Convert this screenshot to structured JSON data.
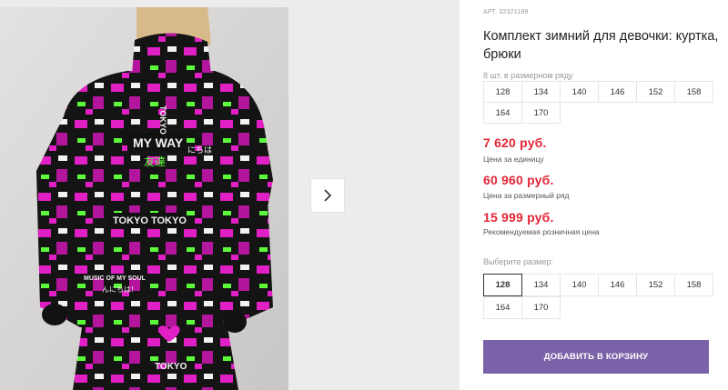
{
  "product": {
    "article": "АРТ. 32321189",
    "title": "Комплект зимний для девочки: куртка, брюки"
  },
  "range": {
    "label": "8 шт. в размерном ряду",
    "sizes": [
      "128",
      "134",
      "140",
      "146",
      "152",
      "158",
      "164",
      "170"
    ]
  },
  "prices": [
    {
      "value": "7 620 руб.",
      "note": "Цена за единицу"
    },
    {
      "value": "60 960 руб.",
      "note": "Цена за размерный ряд"
    },
    {
      "value": "15 999 руб.",
      "note": "Рекомендуемая розничная цена"
    }
  ],
  "size_picker": {
    "label": "Выберите размер:",
    "selected": "128",
    "sizes": [
      "128",
      "134",
      "140",
      "146",
      "152",
      "158",
      "164",
      "170"
    ]
  },
  "cart_button_label": "ДОБАВИТЬ В КОРЗИНУ",
  "gallery": {
    "next_icon": "chevron-right-icon",
    "print_texts": [
      "TOKYO",
      "MY WAY",
      "友達",
      "にちは",
      "TOKYO TOKYO",
      "MUSIC OF MY SOUL",
      "んにちは!",
      "TOKYO"
    ]
  },
  "colors": {
    "price": "#e32636",
    "button": "#7a62a8",
    "print_pink": "#e01fc4",
    "print_green": "#5dfc3a"
  }
}
